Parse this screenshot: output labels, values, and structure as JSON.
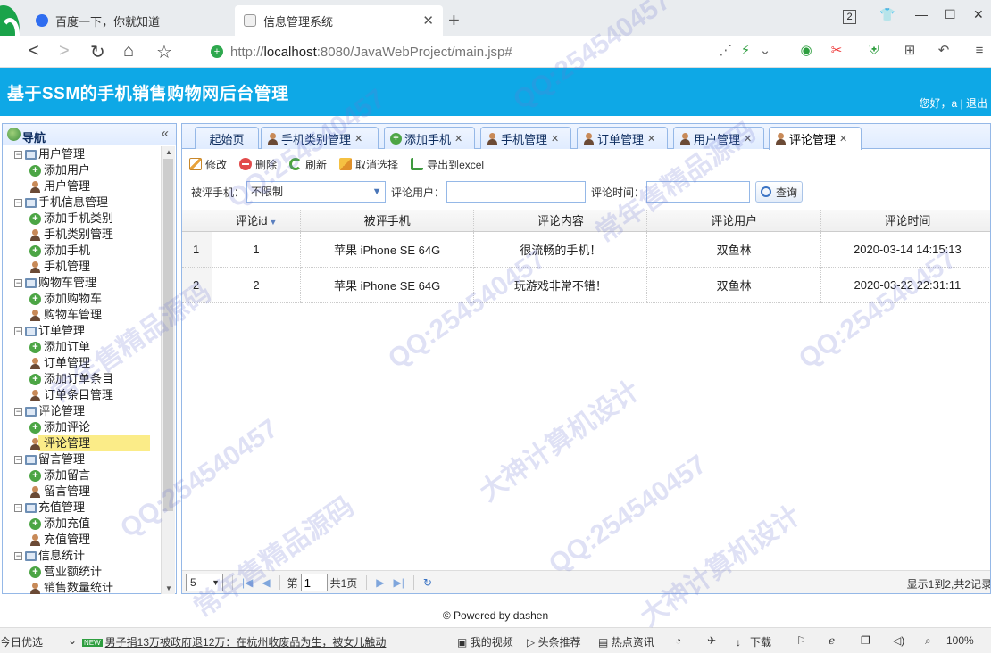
{
  "browser": {
    "tabs": [
      {
        "title": "百度一下，你就知道",
        "active": false
      },
      {
        "title": "信息管理系统",
        "active": true
      }
    ],
    "tab_count": "2",
    "url_host": "localhost",
    "url_rest": ":8080/JavaWebProject/main.jsp#",
    "url_prefix": "http://"
  },
  "app": {
    "title": "基于SSM的手机销售购物网后台管理",
    "greeting": "您好，a",
    "separator": "|",
    "logout": "退出"
  },
  "sidebar": {
    "title": "导航",
    "groups": [
      {
        "label": "用户管理",
        "items": [
          {
            "label": "添加用户",
            "icon": "add"
          },
          {
            "label": "用户管理",
            "icon": "user"
          }
        ]
      },
      {
        "label": "手机信息管理",
        "items": [
          {
            "label": "添加手机类别",
            "icon": "add"
          },
          {
            "label": "手机类别管理",
            "icon": "user"
          },
          {
            "label": "添加手机",
            "icon": "add"
          },
          {
            "label": "手机管理",
            "icon": "user"
          }
        ]
      },
      {
        "label": "购物车管理",
        "items": [
          {
            "label": "添加购物车",
            "icon": "add"
          },
          {
            "label": "购物车管理",
            "icon": "user"
          }
        ]
      },
      {
        "label": "订单管理",
        "items": [
          {
            "label": "添加订单",
            "icon": "add"
          },
          {
            "label": "订单管理",
            "icon": "user"
          },
          {
            "label": "添加订单条目",
            "icon": "add"
          },
          {
            "label": "订单条目管理",
            "icon": "user"
          }
        ]
      },
      {
        "label": "评论管理",
        "items": [
          {
            "label": "添加评论",
            "icon": "add"
          },
          {
            "label": "评论管理",
            "icon": "user",
            "selected": true
          }
        ]
      },
      {
        "label": "留言管理",
        "items": [
          {
            "label": "添加留言",
            "icon": "add"
          },
          {
            "label": "留言管理",
            "icon": "user"
          }
        ]
      },
      {
        "label": "充值管理",
        "items": [
          {
            "label": "添加充值",
            "icon": "add"
          },
          {
            "label": "充值管理",
            "icon": "user"
          }
        ]
      },
      {
        "label": "信息统计",
        "items": [
          {
            "label": "营业额统计",
            "icon": "add"
          },
          {
            "label": "销售数量统计",
            "icon": "user"
          }
        ]
      }
    ]
  },
  "content_tabs": [
    {
      "label": "起始页",
      "icon": "none",
      "closable": false
    },
    {
      "label": "手机类别管理",
      "icon": "user",
      "closable": true
    },
    {
      "label": "添加手机",
      "icon": "add",
      "closable": true
    },
    {
      "label": "手机管理",
      "icon": "user",
      "closable": true
    },
    {
      "label": "订单管理",
      "icon": "user",
      "closable": true
    },
    {
      "label": "用户管理",
      "icon": "user",
      "closable": true
    },
    {
      "label": "评论管理",
      "icon": "user",
      "closable": true,
      "active": true
    }
  ],
  "toolbar": {
    "edit": "修改",
    "delete": "删除",
    "refresh": "刷新",
    "unselect": "取消选择",
    "export": "导出到excel"
  },
  "filter": {
    "phone_label": "被评手机：",
    "phone_value": "不限制",
    "user_label": "评论用户：",
    "user_value": "",
    "time_label": "评论时间：",
    "time_value": "",
    "query": "查询"
  },
  "grid": {
    "columns": [
      "评论id",
      "被评手机",
      "评论内容",
      "评论用户",
      "评论时间"
    ],
    "rows": [
      {
        "rownum": "1",
        "id": "1",
        "phone": "苹果 iPhone SE 64G",
        "content": "很流畅的手机！",
        "user": "双鱼林",
        "time": "2020-03-14 14:15:13"
      },
      {
        "rownum": "2",
        "id": "2",
        "phone": "苹果 iPhone SE 64G",
        "content": "玩游戏非常不错！",
        "user": "双鱼林",
        "time": "2020-03-22 22:31:11"
      }
    ]
  },
  "pager": {
    "page_size": "5",
    "page_prefix": "第",
    "page_value": "1",
    "page_suffix": "共1页",
    "info": "显示1到2,共2记录"
  },
  "footer": "© Powered by dashen",
  "statusbar": {
    "left": "今日优选",
    "new_badge": "NEW",
    "news": "男子捐13万被政府退12万：在杭州收废品为生，被女儿触动",
    "video": "我的视频",
    "headlines": "头条推荐",
    "hot": "热点资讯",
    "download": "下载",
    "zoom": "100%"
  },
  "watermark": {
    "qq": "QQ:254540457",
    "line1": "常年售精品源码",
    "line2": "大神计算机设计"
  },
  "colors": {
    "header": "#0ea8e6",
    "panel_border": "#95b8e7",
    "selected": "#fbec88"
  }
}
